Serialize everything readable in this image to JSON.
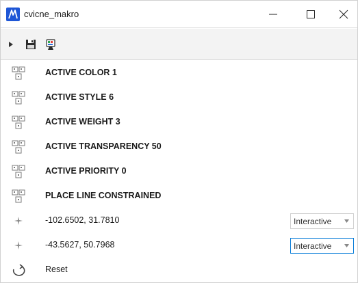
{
  "window": {
    "title": "cvicne_makro",
    "accent_color": "#1e56d6"
  },
  "toolbar": {
    "icons": [
      "play-icon",
      "save-icon",
      "paint-icon"
    ]
  },
  "steps": [
    {
      "type": "command",
      "label": "ACTIVE COLOR 1",
      "icon": "key-in-icon"
    },
    {
      "type": "command",
      "label": "ACTIVE STYLE 6",
      "icon": "key-in-icon"
    },
    {
      "type": "command",
      "label": "ACTIVE WEIGHT 3",
      "icon": "key-in-icon"
    },
    {
      "type": "command",
      "label": "ACTIVE TRANSPARENCY 50",
      "icon": "key-in-icon"
    },
    {
      "type": "command",
      "label": "ACTIVE PRIORITY 0",
      "icon": "key-in-icon"
    },
    {
      "type": "command",
      "label": "PLACE LINE CONSTRAINED",
      "icon": "key-in-icon"
    },
    {
      "type": "point",
      "label": "-102.6502, 31.7810",
      "icon": "data-point-icon",
      "mode": "Interactive"
    },
    {
      "type": "point",
      "label": "-43.5627, 50.7968",
      "icon": "data-point-icon",
      "mode": "Interactive"
    },
    {
      "type": "reset",
      "label": "Reset",
      "icon": "reset-icon"
    }
  ]
}
